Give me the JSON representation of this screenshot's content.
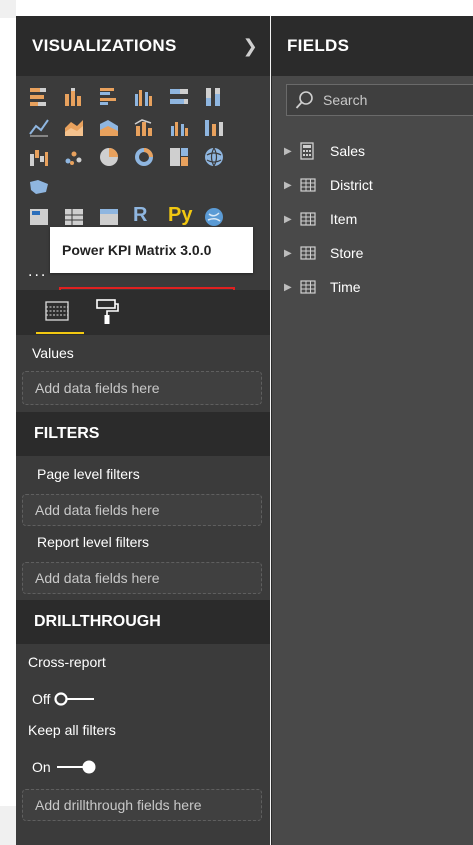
{
  "visualizations": {
    "title": "VISUALIZATIONS",
    "tooltip": "Power KPI Matrix 3.0.0",
    "more": "...",
    "values_label": "Values",
    "values_placeholder": "Add data fields here"
  },
  "filters": {
    "title": "FILTERS",
    "page_level": "Page level filters",
    "page_placeholder": "Add data fields here",
    "report_level": "Report level filters",
    "report_placeholder": "Add data fields here"
  },
  "drillthrough": {
    "title": "DRILLTHROUGH",
    "cross_report_label": "Cross-report",
    "cross_report_state": "Off",
    "keep_filters_label": "Keep all filters",
    "keep_filters_state": "On",
    "placeholder": "Add drillthrough fields here"
  },
  "fields": {
    "title": "FIELDS",
    "search_placeholder": "Search",
    "tables": [
      {
        "name": "Sales",
        "icon": "calculator-icon"
      },
      {
        "name": "District",
        "icon": "table-icon"
      },
      {
        "name": "Item",
        "icon": "table-icon"
      },
      {
        "name": "Store",
        "icon": "table-icon"
      },
      {
        "name": "Time",
        "icon": "table-icon"
      }
    ]
  },
  "colors": {
    "accent": "#f2c811",
    "highlight_border": "#e02020",
    "pane_dark": "#2b2b2b",
    "pane": "#3b3b3b"
  }
}
